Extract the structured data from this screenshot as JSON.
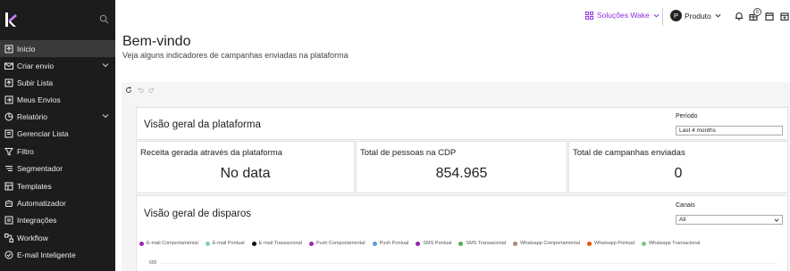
{
  "sidebar": {
    "items": [
      {
        "label": "Início",
        "icon": "home-icon",
        "active": true
      },
      {
        "label": "Criar envio",
        "icon": "mail-icon",
        "has_chevron": true
      },
      {
        "label": "Subir Lista",
        "icon": "upload-icon"
      },
      {
        "label": "Meus Envios",
        "icon": "send-icon"
      },
      {
        "label": "Relatório",
        "icon": "chart-pie-icon",
        "has_chevron": true
      },
      {
        "label": "Gerenciar Lista",
        "icon": "list-icon"
      },
      {
        "label": "Filtro",
        "icon": "filter-icon"
      },
      {
        "label": "Segmentador",
        "icon": "segment-icon"
      },
      {
        "label": "Templates",
        "icon": "template-icon"
      },
      {
        "label": "Automatizador",
        "icon": "robot-icon"
      },
      {
        "label": "Integrações",
        "icon": "plug-icon"
      },
      {
        "label": "Workflow",
        "icon": "workflow-icon"
      },
      {
        "label": "E-mail Inteligente",
        "icon": "smart-mail-icon"
      }
    ]
  },
  "topbar": {
    "solutions_label": "Soluções Wake",
    "accent": "#8a2be2",
    "avatar_letter": "P",
    "profile_label": "Produto",
    "notification_count": "6"
  },
  "header": {
    "title": "Bem-vindo",
    "subtitle": "Veja alguns indicadores de campanhas enviadas na plataforma"
  },
  "overview": {
    "title": "Visão geral da plataforma",
    "period_label": "Período",
    "period_value": "Last 4 months",
    "kpis": [
      {
        "label": "Receita gerada através da plataforma",
        "value": "No data"
      },
      {
        "label": "Total de pessoas na CDP",
        "value": "854.965"
      },
      {
        "label": "Total de campanhas enviadas",
        "value": "0"
      }
    ]
  },
  "dispatch": {
    "title": "Visão geral de disparos",
    "channels_label": "Canais",
    "channels_value": "All",
    "legend": [
      {
        "name": "E-mail Comportamental",
        "color": "#9c27b0"
      },
      {
        "name": "E-mail Pontual",
        "color": "#80cbc4"
      },
      {
        "name": "E-mail Transacional",
        "color": "#111111"
      },
      {
        "name": "Push Comportamental",
        "color": "#9c27b0"
      },
      {
        "name": "Push Pontual",
        "color": "#5c9bd5"
      },
      {
        "name": "SMS Pontual",
        "color": "#8e24aa"
      },
      {
        "name": "SMS Transacional",
        "color": "#4caf50"
      },
      {
        "name": "Whatsapp Comportamental",
        "color": "#a1887f"
      },
      {
        "name": "Whatsapp Pontual",
        "color": "#e65100"
      },
      {
        "name": "Whatsapp Transacional",
        "color": "#81c784"
      }
    ],
    "y_tick": "600"
  }
}
